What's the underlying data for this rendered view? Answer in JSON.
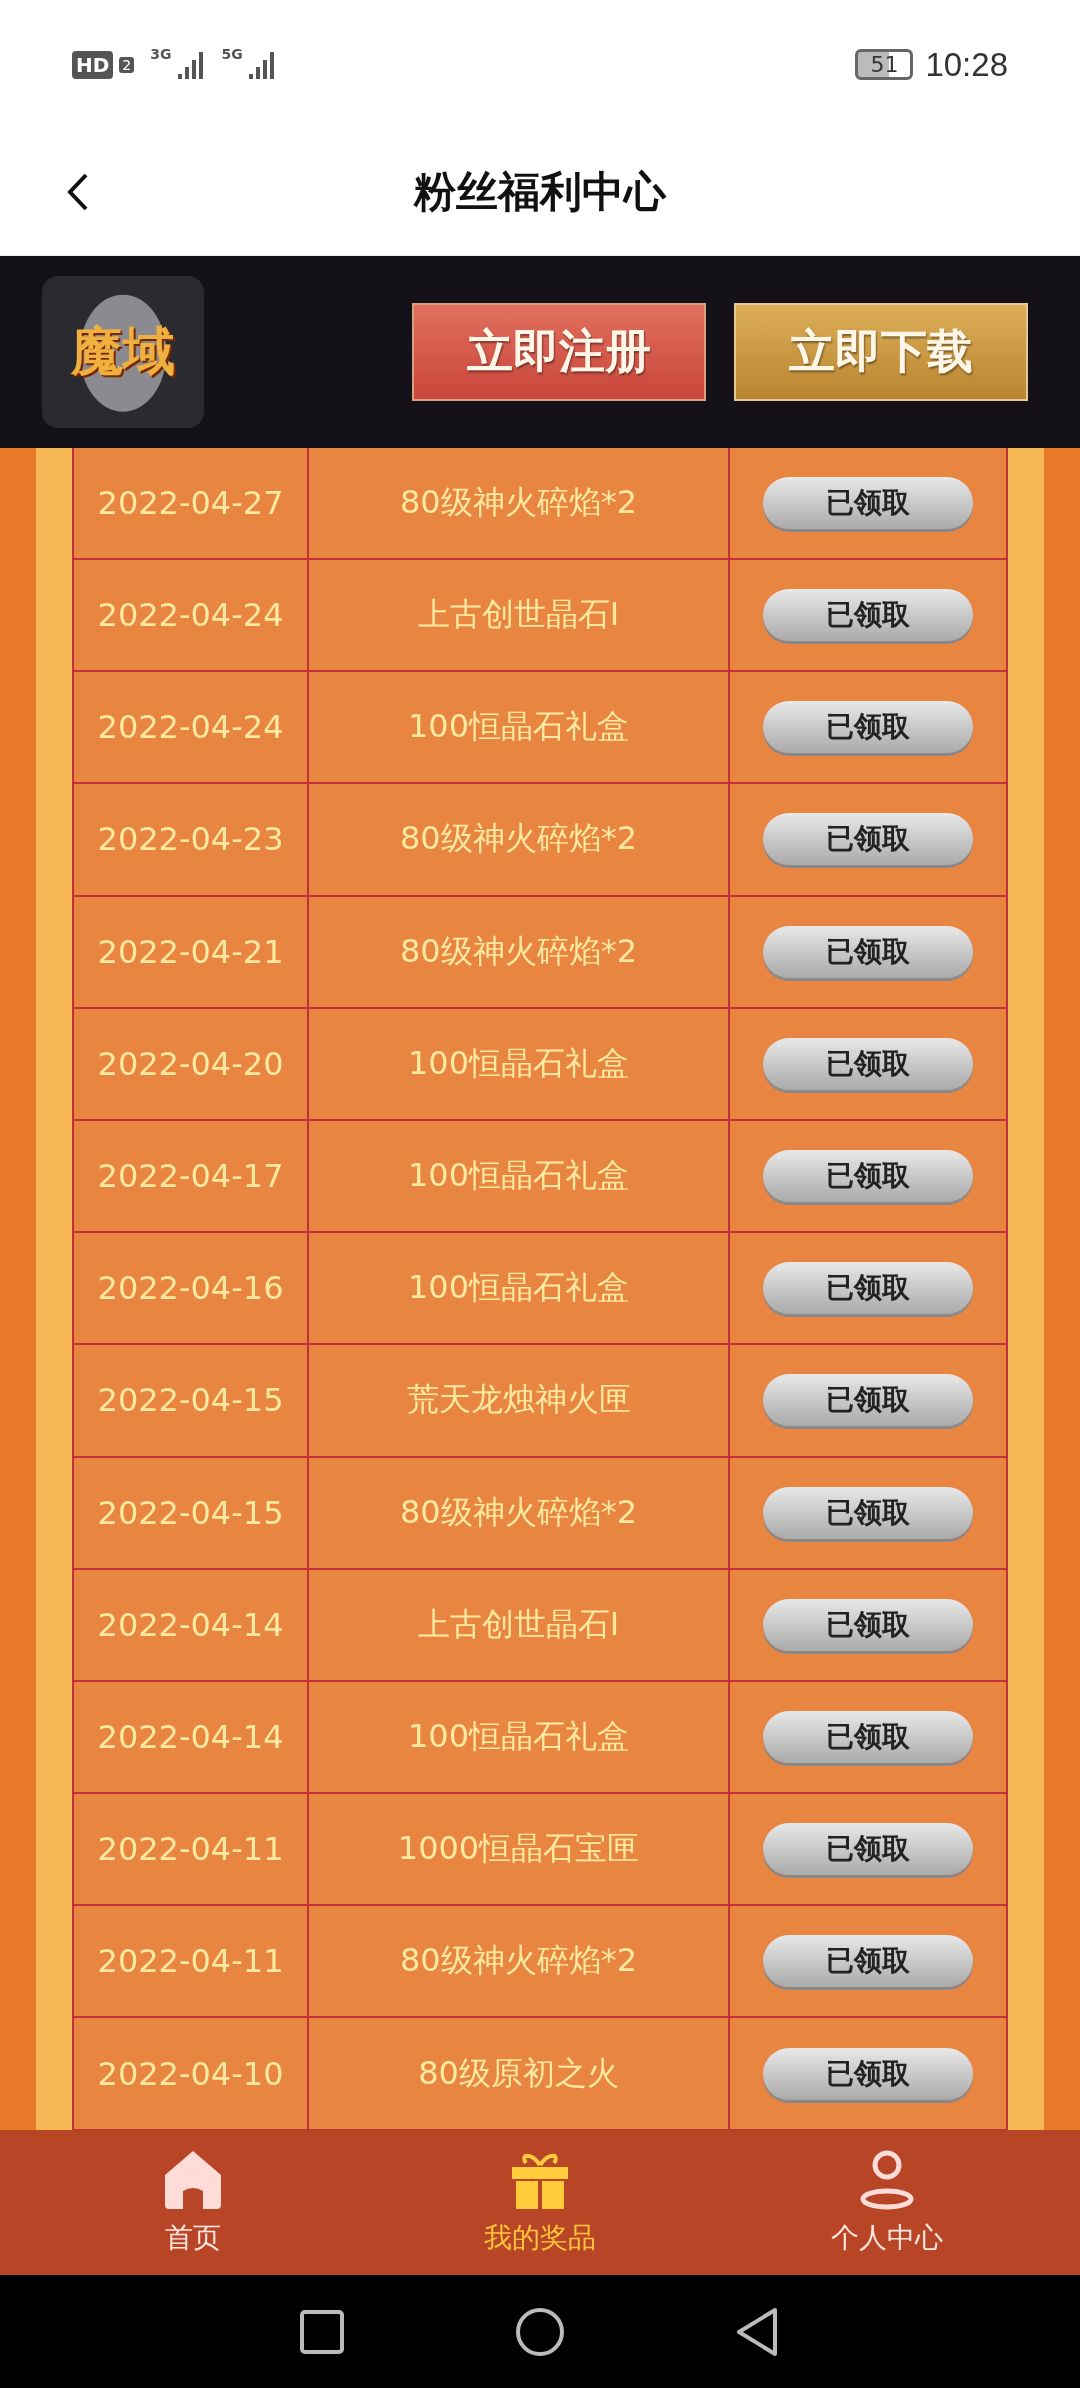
{
  "status_bar": {
    "hd": "HD",
    "sim": "2",
    "net1": "3G",
    "net2": "5G",
    "battery": "51",
    "time": "10:28"
  },
  "header": {
    "title": "粉丝福利中心"
  },
  "banner": {
    "logo": "魔域",
    "buttons": [
      {
        "label": "立即注册",
        "kind": "register"
      },
      {
        "label": "立即下载",
        "kind": "download"
      }
    ]
  },
  "rewards": [
    {
      "date": "2022-04-27",
      "item": "80级神火碎焰*2",
      "status": "已领取"
    },
    {
      "date": "2022-04-24",
      "item": "上古创世晶石Ⅰ",
      "status": "已领取"
    },
    {
      "date": "2022-04-24",
      "item": "100恒晶石礼盒",
      "status": "已领取"
    },
    {
      "date": "2022-04-23",
      "item": "80级神火碎焰*2",
      "status": "已领取"
    },
    {
      "date": "2022-04-21",
      "item": "80级神火碎焰*2",
      "status": "已领取"
    },
    {
      "date": "2022-04-20",
      "item": "100恒晶石礼盒",
      "status": "已领取"
    },
    {
      "date": "2022-04-17",
      "item": "100恒晶石礼盒",
      "status": "已领取"
    },
    {
      "date": "2022-04-16",
      "item": "100恒晶石礼盒",
      "status": "已领取"
    },
    {
      "date": "2022-04-15",
      "item": "荒天龙烛神火匣",
      "status": "已领取"
    },
    {
      "date": "2022-04-15",
      "item": "80级神火碎焰*2",
      "status": "已领取"
    },
    {
      "date": "2022-04-14",
      "item": "上古创世晶石Ⅰ",
      "status": "已领取"
    },
    {
      "date": "2022-04-14",
      "item": "100恒晶石礼盒",
      "status": "已领取"
    },
    {
      "date": "2022-04-11",
      "item": "1000恒晶石宝匣",
      "status": "已领取"
    },
    {
      "date": "2022-04-11",
      "item": "80级神火碎焰*2",
      "status": "已领取"
    },
    {
      "date": "2022-04-10",
      "item": "80级原初之火",
      "status": "已领取"
    }
  ],
  "tab_bar": [
    {
      "label": "首页",
      "kind": "home",
      "selected": false
    },
    {
      "label": "我的奖品",
      "kind": "gift",
      "selected": true
    },
    {
      "label": "个人中心",
      "kind": "user",
      "selected": false
    }
  ]
}
